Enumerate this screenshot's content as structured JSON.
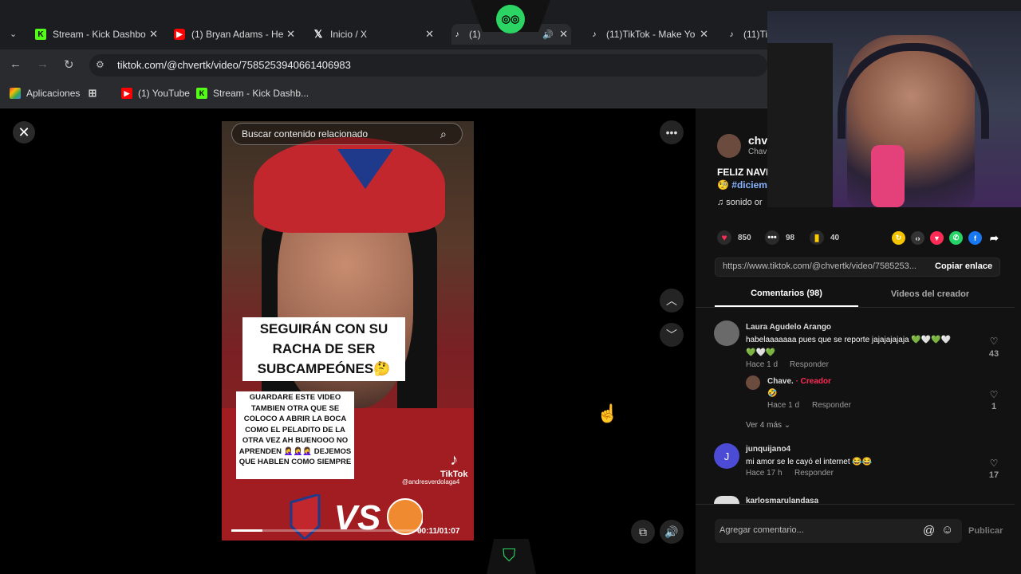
{
  "browser": {
    "tabs": [
      {
        "label": "Stream - Kick Dashbo",
        "favicon": "kick",
        "color": "#53fc18"
      },
      {
        "label": "(1) Bryan Adams - He",
        "favicon": "youtube",
        "color": "#ff0000"
      },
      {
        "label": "Inicio / X",
        "favicon": "x",
        "color": "#ffffff"
      },
      {
        "label": "(1)",
        "favicon": "tiktok",
        "color": "#ffffff"
      },
      {
        "label": "(11)TikTok - Make Yo",
        "favicon": "tiktok",
        "color": "#ffffff"
      },
      {
        "label": "(11)Ti",
        "favicon": "tiktok",
        "color": "#ffffff"
      }
    ],
    "url": "tiktok.com/@chvertk/video/7585253940661406983",
    "bookmarks": [
      {
        "label": "Aplicaciones",
        "icon": "apps-grid-icon"
      },
      {
        "label": "",
        "icon": "grid-icon"
      },
      {
        "label": "(1) YouTube",
        "icon": "youtube"
      },
      {
        "label": "Stream - Kick Dashb...",
        "icon": "kick"
      }
    ]
  },
  "video": {
    "search_placeholder": "Buscar contenido relacionado",
    "caption_main": "SEGUIRÁN CON SU RACHA DE SER SUBCAMPEÓNES🤔",
    "caption_secondary": "GUARDARE ESTE VIDEO TAMBIEN OTRA QUE SE COLOCO A ABRIR LA BOCA COMO EL PELADITO DE LA OTRA VEZ AH BUENOOO NO APRENDEN 🤦‍♀️🤦‍♀️🤦‍♀️ DEJEMOS QUE HABLEN COMO SIEMPRE",
    "watermark": "TikTok",
    "watermark_user": "@andresverdolaga4",
    "vs_text": "VS",
    "time": "00:11/01:07",
    "progress": 0.164
  },
  "panel": {
    "creator_name": "chv",
    "creator_sub": "Chav",
    "description": "FELIZ NAVI",
    "hashtag": "🧐 #diciem",
    "sound": "♫  sonido or",
    "stats": [
      {
        "icon": "heart-icon",
        "value": "850",
        "color": "#fe2c55"
      },
      {
        "icon": "comment-icon",
        "value": "98",
        "color": "#555"
      },
      {
        "icon": "bookmark-icon",
        "value": "40",
        "color": "#facd00"
      }
    ],
    "share_icons": [
      {
        "name": "repost-icon",
        "color": "#f5c400",
        "glyph": "↻"
      },
      {
        "name": "embed-icon",
        "color": "#333",
        "glyph": "‹›"
      },
      {
        "name": "send-icon",
        "color": "#fe2c55",
        "glyph": "▼"
      },
      {
        "name": "whatsapp-icon",
        "color": "#25d366",
        "glyph": "✆"
      },
      {
        "name": "facebook-icon",
        "color": "#1877f2",
        "glyph": "f"
      },
      {
        "name": "share-arrow-icon",
        "color": "#121212",
        "glyph": "➦"
      }
    ],
    "share_link": "https://www.tiktok.com/@chvertk/video/7585253...",
    "copy_link": "Copiar enlace",
    "tab_comments": "Comentarios (98)",
    "tab_videos": "Videos del creador",
    "comments": [
      {
        "user": "Laura Agudelo Arango",
        "text1": "habelaaaaaaa pues que se reporte jajajajajaja 💚🤍💚🤍",
        "text2": "💚🤍💚",
        "time": "Hace 1 d",
        "reply": "Responder",
        "likes": "43"
      },
      {
        "user": "Chave.",
        "creator_tag": "· Creador",
        "text1": "🤣",
        "time": "Hace 1 d",
        "reply": "Responder",
        "likes": "1"
      },
      {
        "user": "junquijano4",
        "text1": "mi amor se le cayó el internet 😂😂",
        "time": "Hace 17 h",
        "reply": "Responder",
        "likes": "17",
        "initial": "J"
      },
      {
        "user": "karlosmarulandasa"
      }
    ],
    "see_more": "Ver 4 más  ⌄",
    "comment_placeholder": "Agregar comentario...",
    "publish": "Publicar"
  }
}
